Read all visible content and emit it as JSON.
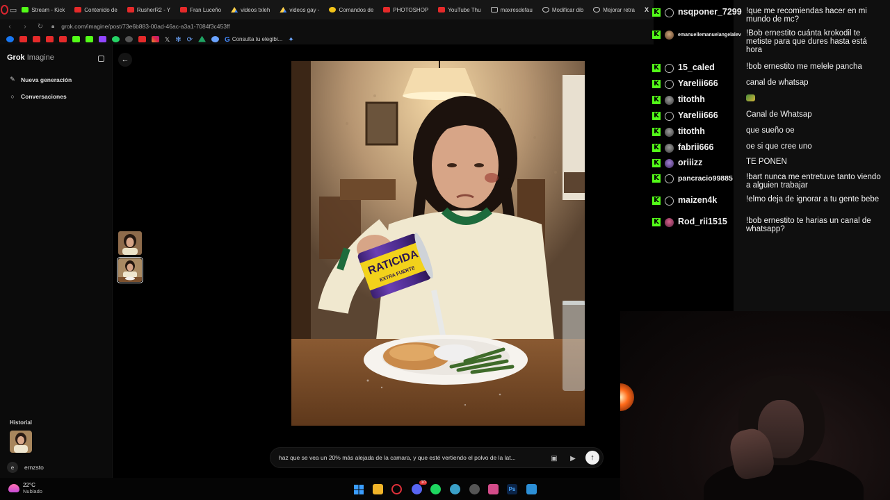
{
  "browser": {
    "tabs": [
      {
        "icon": "kick",
        "label": "Stream - Kick"
      },
      {
        "icon": "yt",
        "label": "Contenido de"
      },
      {
        "icon": "yt",
        "label": "RusherR2 - Y"
      },
      {
        "icon": "yt",
        "label": "Fran Luceño"
      },
      {
        "icon": "drive",
        "label": "videos txleh"
      },
      {
        "icon": "drive",
        "label": "videos gay -"
      },
      {
        "icon": "cmd",
        "label": "Comandos de"
      },
      {
        "icon": "yt",
        "label": "PHOTOSHOP"
      },
      {
        "icon": "yt",
        "label": "YouTube Thu"
      },
      {
        "icon": "doc",
        "label": "maxresdefau"
      },
      {
        "icon": "gear",
        "label": "Modificar dib"
      },
      {
        "icon": "gear",
        "label": "Mejorar retra"
      }
    ],
    "close_glyph": "X",
    "url": "grok.com/imagine/post/73e6b883-00ad-46ac-a3a1-7084f3c453ff",
    "bookmark_text": "Consulta tu elegibi..."
  },
  "sidebar": {
    "brand_primary": "Grok",
    "brand_secondary": "Imagine",
    "items": [
      {
        "label": "Nueva generación",
        "icon": "edit-icon"
      },
      {
        "label": "Conversaciones",
        "icon": "chat-bubble-icon"
      }
    ],
    "history_label": "Historial",
    "user_initial": "e",
    "user_name": "ernzsto"
  },
  "prompt": {
    "text": "haz que se vea un 20% más alejada de la camara, y que esté vertiendo el polvo de la lat..."
  },
  "image": {
    "can_label_line1": "RATICIDA",
    "can_label_line2": "EXTRA FUERTE"
  },
  "taskbar": {
    "temperature": "22°C",
    "condition": "Nublado",
    "discord_badge": "10"
  },
  "chat": {
    "messages": [
      {
        "user": "nsqponer_7299",
        "avatar": "plain",
        "text": "!que me recomiendas hacer en mi mundo de mc?"
      },
      {
        "user": "emanuellemanuelangelalev",
        "avatar": "av1",
        "text": "!Bob ernestito cuánta krokodil te metiste para que dures hasta está hora"
      },
      {
        "user": "15_caled",
        "avatar": "plain",
        "text": "!bob ernestito me melele pancha"
      },
      {
        "user": "Yarelii666",
        "avatar": "plain",
        "text": "canal de whatsap"
      },
      {
        "user": "titothh",
        "avatar": "av2",
        "text": ""
      },
      {
        "user": "Yarelii666",
        "avatar": "plain",
        "text": "Canal de Whatsap"
      },
      {
        "user": "titothh",
        "avatar": "av2",
        "text": "que sueño oe"
      },
      {
        "user": "fabrii666",
        "avatar": "av2",
        "text": "oe si que cree uno"
      },
      {
        "user": "oriiizz",
        "avatar": "av3",
        "text": "TE PONEN"
      },
      {
        "user": "pancracio99885",
        "avatar": "plain",
        "text": "!bart nunca me entretuve tanto viendo a alguien trabajar"
      },
      {
        "user": "maizen4k",
        "avatar": "plain",
        "text": "!elmo deja de ignorar a tu gente bebe"
      },
      {
        "user": "Rod_rii1515",
        "avatar": "av4",
        "text": "!bob ernestito te harias un canal de whatsapp?"
      }
    ]
  }
}
